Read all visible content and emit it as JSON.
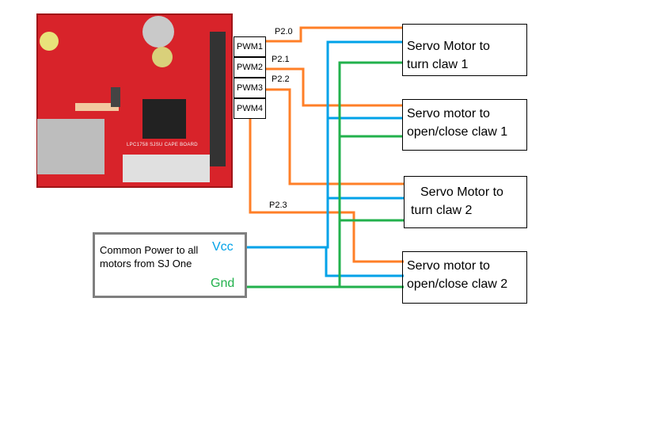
{
  "board": {
    "name": "LPC1758 SJSU CAPE BOARD",
    "color": "#d8232a"
  },
  "pwm_ports": [
    "PWM1",
    "PWM2",
    "PWM3",
    "PWM4"
  ],
  "pin_labels": [
    "P2.0",
    "P2.1",
    "P2.2",
    "P2.3"
  ],
  "servos": [
    {
      "line1": "Servo Motor to",
      "line2": "turn claw 1"
    },
    {
      "line1": "Servo motor to",
      "line2": "open/close claw 1"
    },
    {
      "line1": "Servo Motor to",
      "line2": "turn claw 2"
    },
    {
      "line1": "Servo motor to",
      "line2": "open/close claw 2"
    }
  ],
  "power": {
    "text": "Common Power to all motors from SJ One",
    "vcc": "Vcc",
    "gnd": "Gnd"
  },
  "colors": {
    "signal": "#ff7f27",
    "vcc": "#00a2e8",
    "gnd": "#22b14c",
    "power_box": "#7f7f7f"
  }
}
